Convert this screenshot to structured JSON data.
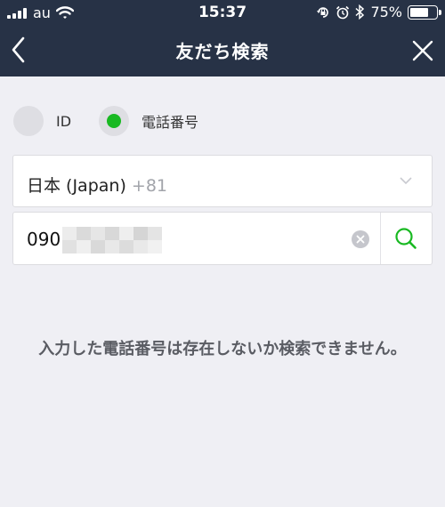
{
  "status_bar": {
    "carrier": "au",
    "time": "15:37",
    "battery_percent": "75%",
    "battery_level": 0.75,
    "icons": [
      "signal-icon",
      "wifi-icon",
      "orientation-lock-icon",
      "alarm-icon",
      "bluetooth-icon",
      "battery-icon"
    ]
  },
  "nav": {
    "title": "友だち検索",
    "back_icon": "chevron-left-icon",
    "close_icon": "close-icon"
  },
  "search_type": {
    "options": [
      {
        "label": "ID",
        "selected": false
      },
      {
        "label": "電話番号",
        "selected": true
      }
    ]
  },
  "country": {
    "name": "日本 (Japan)",
    "code": "+81",
    "chevron_icon": "chevron-down-icon"
  },
  "phone": {
    "value_prefix": "090",
    "clear_icon": "clear-icon",
    "search_icon": "search-icon"
  },
  "message": "入力した電話番号は存在しないか検索できません。",
  "colors": {
    "header_bg": "#273246",
    "page_bg": "#efeff4",
    "accent_green": "#19b922",
    "message_text": "#5a5c63"
  }
}
